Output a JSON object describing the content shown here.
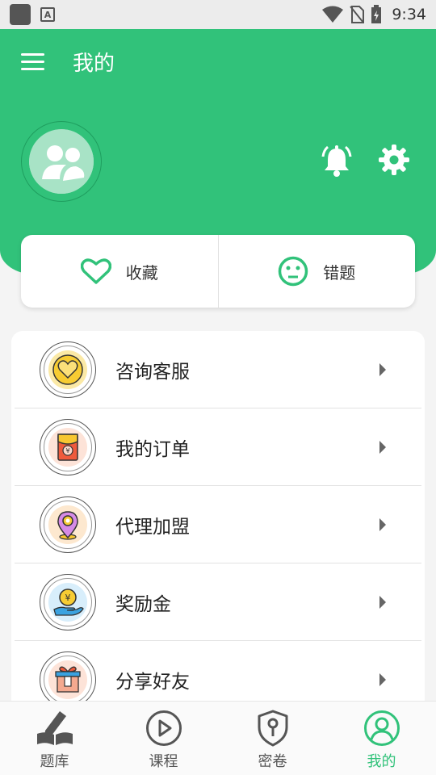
{
  "status_bar": {
    "time": "9:34",
    "app_glyph": "A"
  },
  "header": {
    "title": "我的"
  },
  "quick_actions": [
    {
      "label": "收藏",
      "icon": "heart-icon"
    },
    {
      "label": "错题",
      "icon": "sad-face-icon"
    }
  ],
  "menu": [
    {
      "label": "咨询客服",
      "icon": "heart-badge-icon"
    },
    {
      "label": "我的订单",
      "icon": "red-envelope-icon"
    },
    {
      "label": "代理加盟",
      "icon": "location-pin-icon"
    },
    {
      "label": "奖励金",
      "icon": "coin-hand-icon"
    },
    {
      "label": "分享好友",
      "icon": "gift-box-icon"
    }
  ],
  "bottom_nav": [
    {
      "label": "题库",
      "icon": "book-pen-icon",
      "active": false
    },
    {
      "label": "课程",
      "icon": "play-circle-icon",
      "active": false
    },
    {
      "label": "密卷",
      "icon": "shield-key-icon",
      "active": false
    },
    {
      "label": "我的",
      "icon": "user-circle-icon",
      "active": true
    }
  ],
  "colors": {
    "primary": "#31c27a",
    "avatar_bg": "#a8e3c6"
  }
}
